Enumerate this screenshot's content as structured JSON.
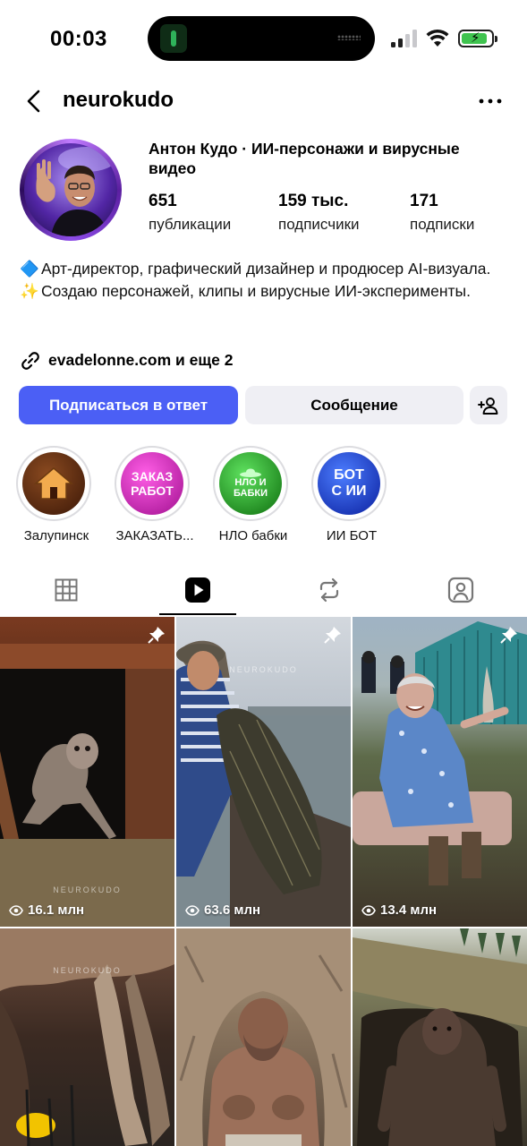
{
  "status_bar": {
    "time": "00:03",
    "signal_color_active": "#1f1f1f",
    "signal_color_inactive": "#c8c8cc",
    "battery_color": "#3fc34f",
    "battery_level": 0.8
  },
  "header": {
    "username": "neurokudo",
    "back_icon": "chevron-left-icon",
    "more_icon": "ellipsis-icon"
  },
  "profile": {
    "display_name": "Антон Кудо · ИИ-персонажи и вирусные видео",
    "stats": [
      {
        "value": "651",
        "label": "публикации"
      },
      {
        "value": "159 тыс.",
        "label": "подписчики"
      },
      {
        "value": "171",
        "label": "подписки"
      }
    ],
    "bio": [
      {
        "emoji": "🔷",
        "text": "Арт-директор, графический дизайнер и продюсер AI-визуала."
      },
      {
        "emoji": "✨",
        "text": "Создаю персонажей, клипы и вирусные ИИ-эксперименты."
      }
    ],
    "link": "evadelonne.com и еще 2"
  },
  "actions": {
    "follow_back_label": "Подписаться в ответ",
    "message_label": "Сообщение",
    "add_user_icon": "add-person-icon",
    "accent_color": "#4b5ff5"
  },
  "highlights": [
    {
      "label": "Залупинск",
      "cover_text": "",
      "icon": "house-icon",
      "bg": "#5a2a0f",
      "fg": "#ffffff"
    },
    {
      "label": "ЗАКАЗАТЬ...",
      "cover_text": "ЗАКАЗ РАБОТ",
      "icon": "",
      "bg": "#d01fb5",
      "fg": "#ffffff"
    },
    {
      "label": "НЛО бабки",
      "cover_text": "НЛО И БАБКИ",
      "icon": "ufo-icon",
      "bg": "#1c9b1c",
      "fg": "#ffffff"
    },
    {
      "label": "ИИ БОТ",
      "cover_text": "БОТ С ИИ",
      "icon": "",
      "bg": "#1c3fd8",
      "fg": "#ffffff"
    }
  ],
  "tabs": [
    {
      "name": "grid",
      "icon": "grid-icon",
      "active": false
    },
    {
      "name": "reels",
      "icon": "reels-icon",
      "active": true
    },
    {
      "name": "reposts",
      "icon": "repost-icon",
      "active": false
    },
    {
      "name": "tagged",
      "icon": "tagged-icon",
      "active": false
    }
  ],
  "grid": {
    "watermark": "NEUROKUDO",
    "tiles": [
      {
        "views": "16.1 млн",
        "pinned": true,
        "subject": "creature in cellar"
      },
      {
        "views": "63.6 млн",
        "pinned": true,
        "subject": "fisherman with net"
      },
      {
        "views": "13.4 млн",
        "pinned": true,
        "subject": "grandmother with rocket"
      },
      {
        "views": "",
        "pinned": false,
        "subject": "cave"
      },
      {
        "views": "",
        "pinned": false,
        "subject": "giant in cave"
      },
      {
        "views": "",
        "pinned": false,
        "subject": "bigfoot at burrow"
      }
    ]
  }
}
